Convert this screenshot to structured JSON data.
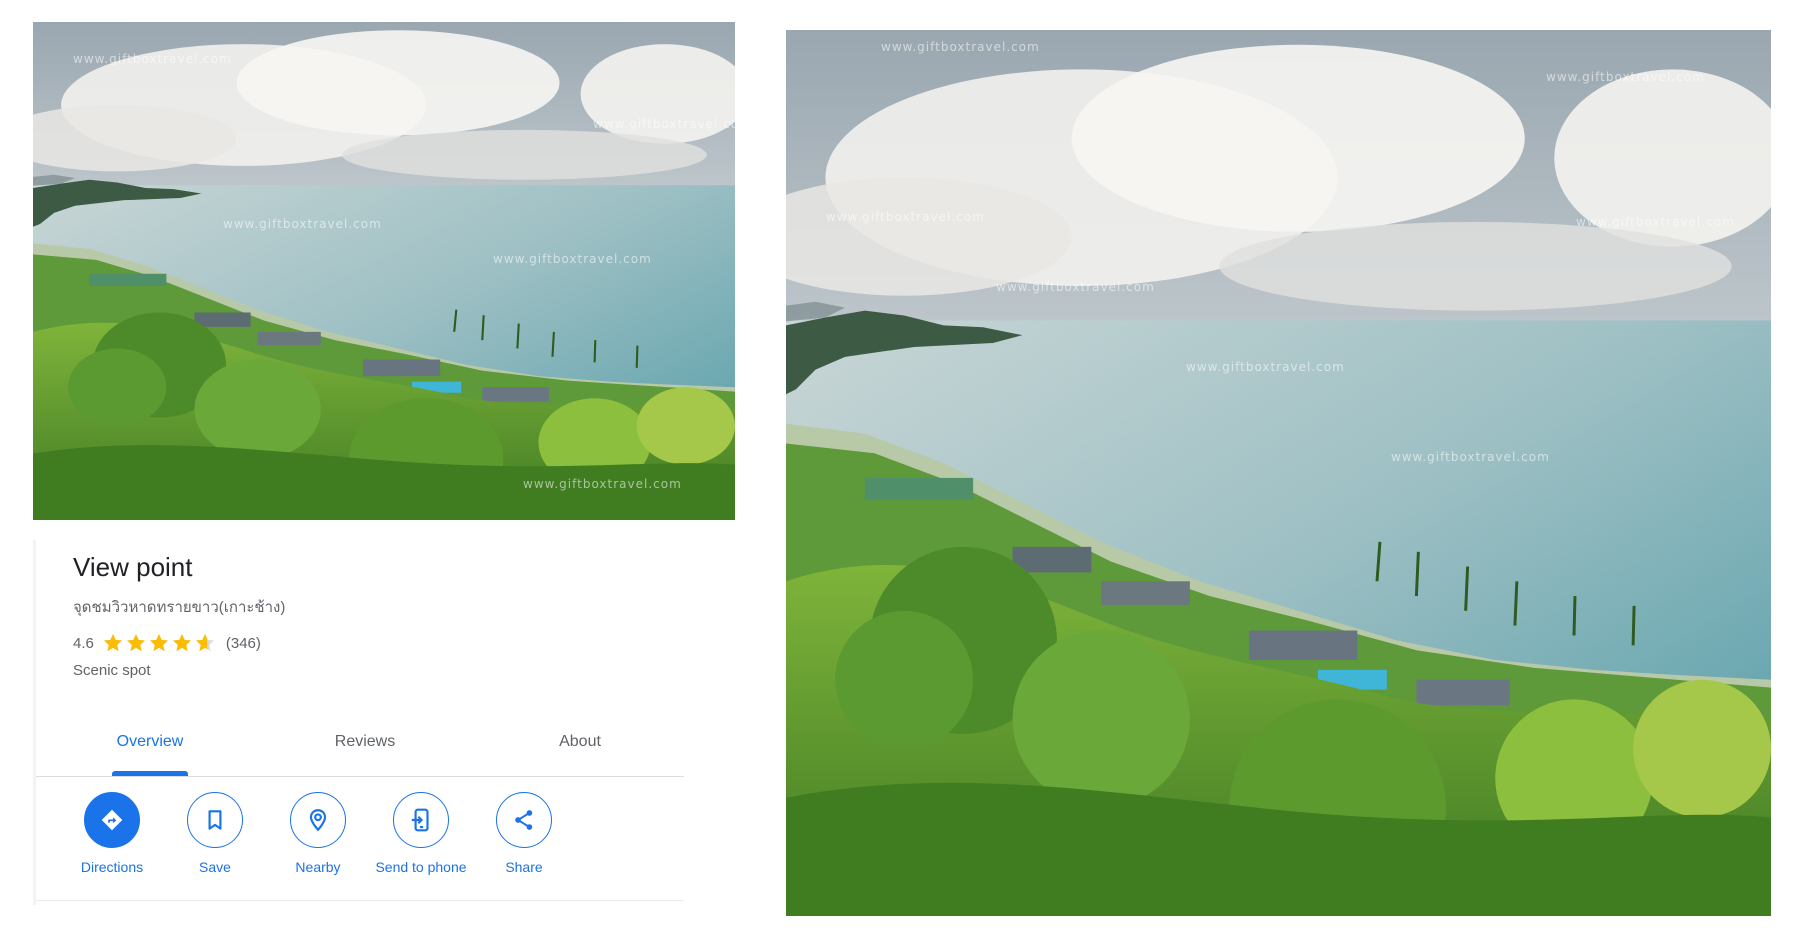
{
  "place": {
    "title": "View point",
    "subtitle": "จุดชมวิวหาดทรายขาว(เกาะช้าง)",
    "rating": "4.6",
    "stars": 4.6,
    "review_count": "(346)",
    "category": "Scenic spot"
  },
  "tabs": [
    {
      "label": "Overview",
      "active": true
    },
    {
      "label": "Reviews",
      "active": false
    },
    {
      "label": "About",
      "active": false
    }
  ],
  "actions": [
    {
      "label": "Directions",
      "icon": "directions-icon"
    },
    {
      "label": "Save",
      "icon": "bookmark-icon"
    },
    {
      "label": "Nearby",
      "icon": "nearby-icon"
    },
    {
      "label": "Send to phone",
      "icon": "send-to-phone-icon"
    },
    {
      "label": "Share",
      "icon": "share-icon"
    }
  ],
  "watermark": "www.giftboxtravel.com",
  "colors": {
    "accent": "#1a73e8",
    "star": "#fbbc04",
    "text": "#202124",
    "muted": "#5f6368"
  }
}
